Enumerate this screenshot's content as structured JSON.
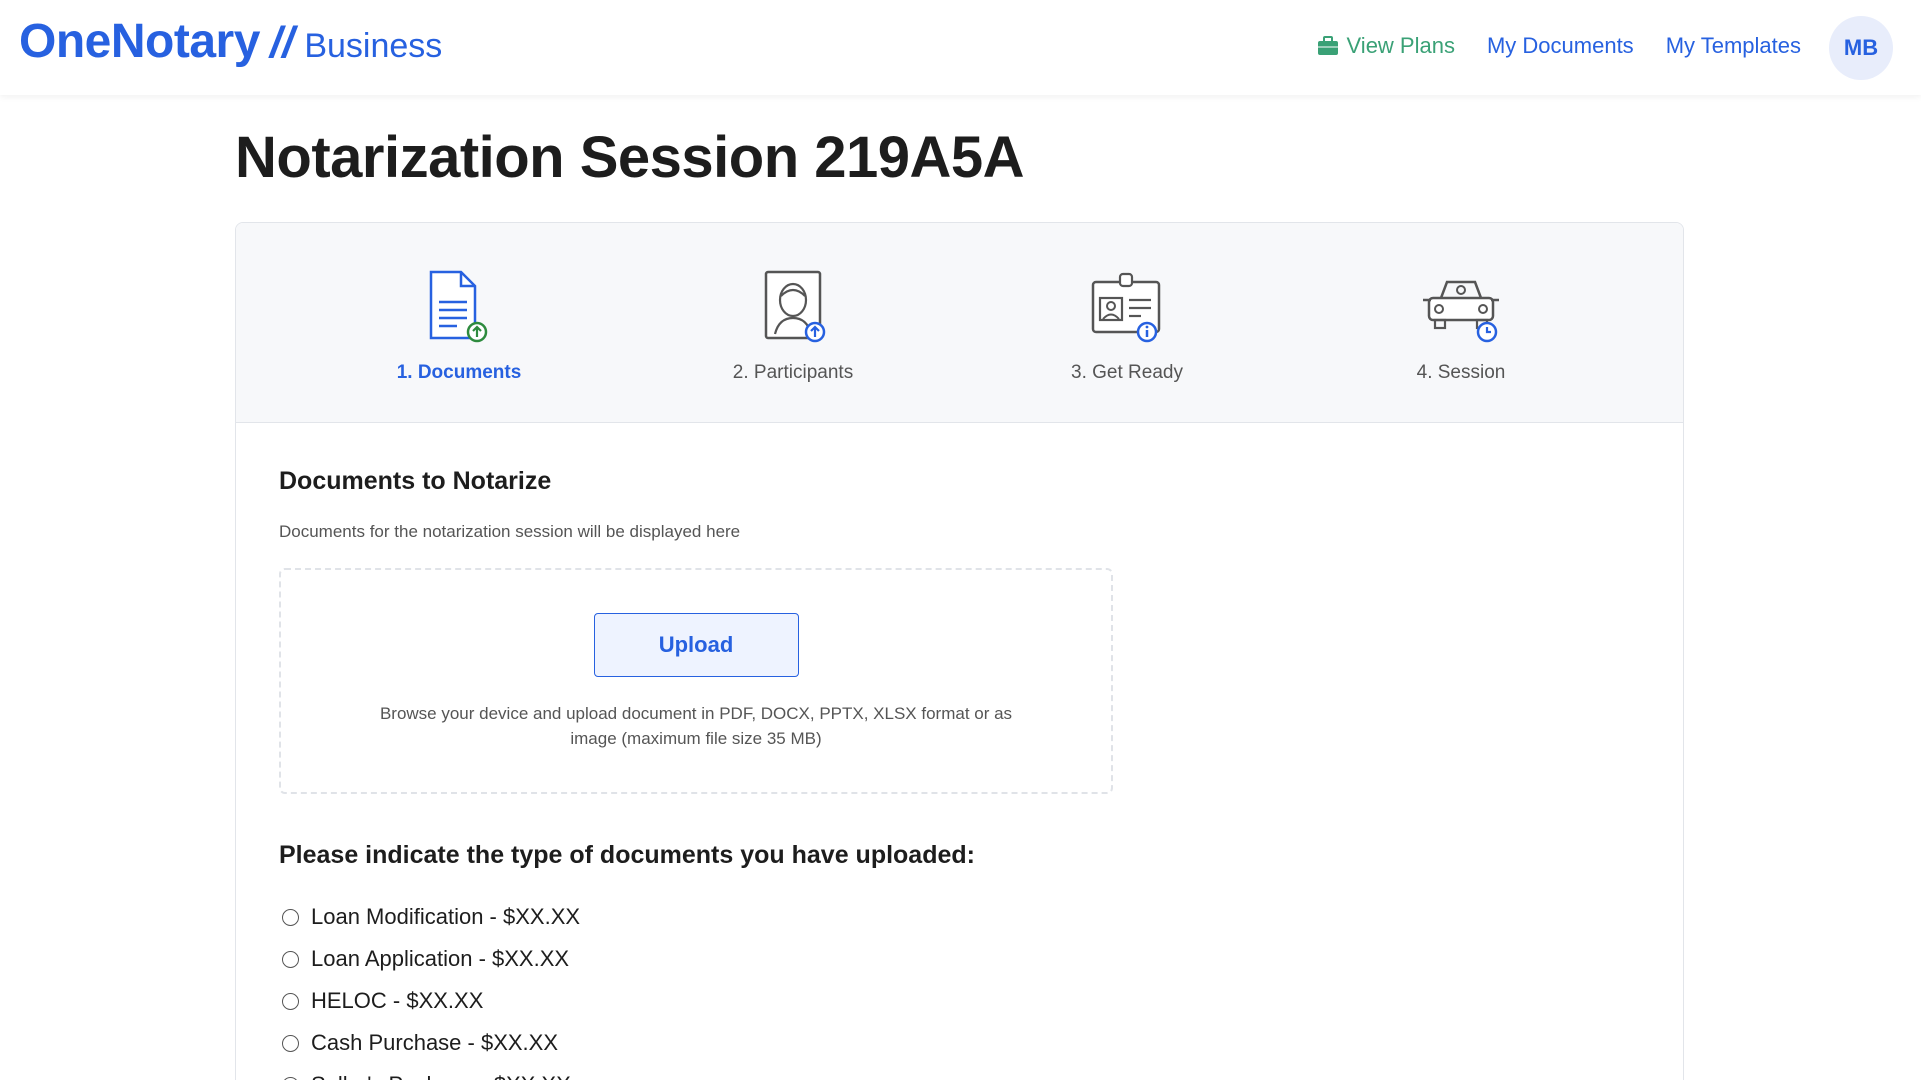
{
  "header": {
    "logo_main": "OneNotary",
    "logo_sep": "//",
    "logo_sub": "Business",
    "nav": {
      "view_plans": "View Plans",
      "my_documents": "My Documents",
      "my_templates": "My Templates"
    },
    "avatar_initials": "MB"
  },
  "page": {
    "title": "Notarization Session 219A5A"
  },
  "stepper": {
    "steps": [
      {
        "label": "1. Documents",
        "icon": "document-upload-icon",
        "active": true
      },
      {
        "label": "2. Participants",
        "icon": "participant-icon",
        "active": false
      },
      {
        "label": "3. Get Ready",
        "icon": "id-card-icon",
        "active": false
      },
      {
        "label": "4. Session",
        "icon": "car-clock-icon",
        "active": false
      }
    ]
  },
  "documents": {
    "title": "Documents to Notarize",
    "subtitle": "Documents for the notarization session will be displayed here",
    "upload_label": "Upload",
    "hint": "Browse your device and upload document in PDF, DOCX, PPTX, XLSX format or as image (maximum file size 35 MB)"
  },
  "doc_type": {
    "question": "Please indicate the type of documents you have uploaded:",
    "options": [
      "Loan Modification - $XX.XX",
      "Loan Application - $XX.XX",
      "HELOC - $XX.XX",
      "Cash Purchase - $XX.XX",
      "Seller's Package - $XX.XX"
    ]
  },
  "colors": {
    "brand_blue": "#2761e0",
    "plans_green": "#3aa176",
    "accent_green": "#2e8b3e"
  }
}
